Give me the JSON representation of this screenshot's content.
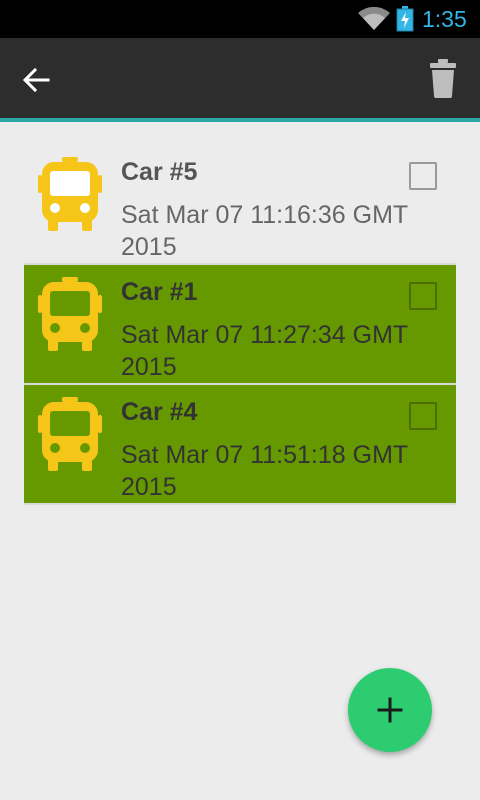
{
  "status_bar": {
    "time": "1:35",
    "icons": [
      "wifi-icon",
      "battery-charging-icon"
    ]
  },
  "app_bar": {
    "back_icon": "arrow-back-icon",
    "action_icon": "trash-icon"
  },
  "cars": [
    {
      "name": "Car #5",
      "date": "Sat Mar 07 11:16:36 GMT 2015",
      "selected": false,
      "checked": false,
      "icon": "bus-icon"
    },
    {
      "name": "Car #1",
      "date": "Sat Mar 07 11:27:34 GMT 2015",
      "selected": true,
      "checked": false,
      "icon": "bus-icon"
    },
    {
      "name": "Car #4",
      "date": "Sat Mar 07 11:51:18 GMT 2015",
      "selected": true,
      "checked": false,
      "icon": "bus-icon"
    }
  ],
  "fab": {
    "icon": "plus-icon"
  },
  "colors": {
    "accent": "#2aa7a0",
    "selected_row": "#669900",
    "bus_icon": "#f5c518",
    "fab": "#2ecc71",
    "clock": "#33b5e5"
  }
}
